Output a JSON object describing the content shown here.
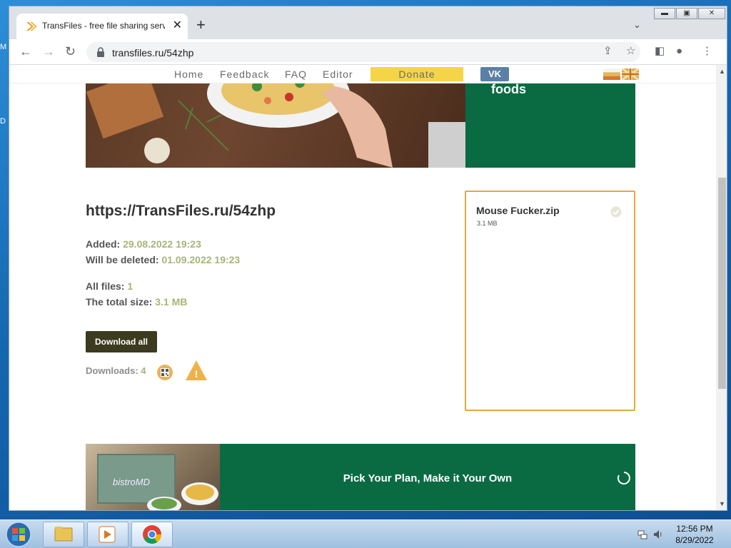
{
  "desktop": {
    "edge_top": "M",
    "edge_mid": "D"
  },
  "browser": {
    "tab_title": "TransFiles - free file sharing servi",
    "tab_close": "✕",
    "new_tab": "+",
    "tab_search": "⌄",
    "window_controls": {
      "minimize": "▬",
      "maximize": "▣",
      "close": "✕"
    },
    "url": "transfiles.ru/54zhp"
  },
  "site_nav": {
    "items": [
      "Home",
      "Feedback",
      "FAQ",
      "Editor"
    ],
    "donate": "Donate",
    "vk": "VK"
  },
  "banner_top": {
    "text": "foods"
  },
  "main": {
    "link_title": "https://TransFiles.ru/54zhp",
    "added_label": "Added: ",
    "added_value": "29.08.2022 19:23",
    "deleted_label": "Will be deleted: ",
    "deleted_value": "01.09.2022 19:23",
    "all_files_label": "All files: ",
    "all_files_value": "1",
    "total_size_label": "The total size: ",
    "total_size_value": "3.1 MB",
    "download_all": "Download all",
    "downloads_label": "Downloads: ",
    "downloads_value": "4"
  },
  "file_card": {
    "name": "Mouse Fucker.zip",
    "size": "3.1 MB"
  },
  "banner_bottom": {
    "text": "Pick Your Plan, Make it Your Own",
    "box_label": "bistroMD"
  },
  "taskbar": {
    "time": "12:56 PM",
    "date": "8/29/2022"
  },
  "colors": {
    "accent_green": "#0a6b43",
    "value_green": "#a6b577",
    "donate_yellow": "#f5d547",
    "vk_blue": "#5c7fa6",
    "card_border": "#e3aa3b",
    "button_dark": "#3c3a1f"
  },
  "icons": [
    "favicon-icon",
    "back-icon",
    "forward-icon",
    "reload-icon",
    "lock-icon",
    "share-icon",
    "star-icon",
    "sidepanel-icon",
    "profile-icon",
    "menu-icon",
    "qr-icon",
    "warning-icon",
    "check-icon",
    "loading-icon",
    "flag-ru-icon",
    "flag-uk-icon"
  ]
}
